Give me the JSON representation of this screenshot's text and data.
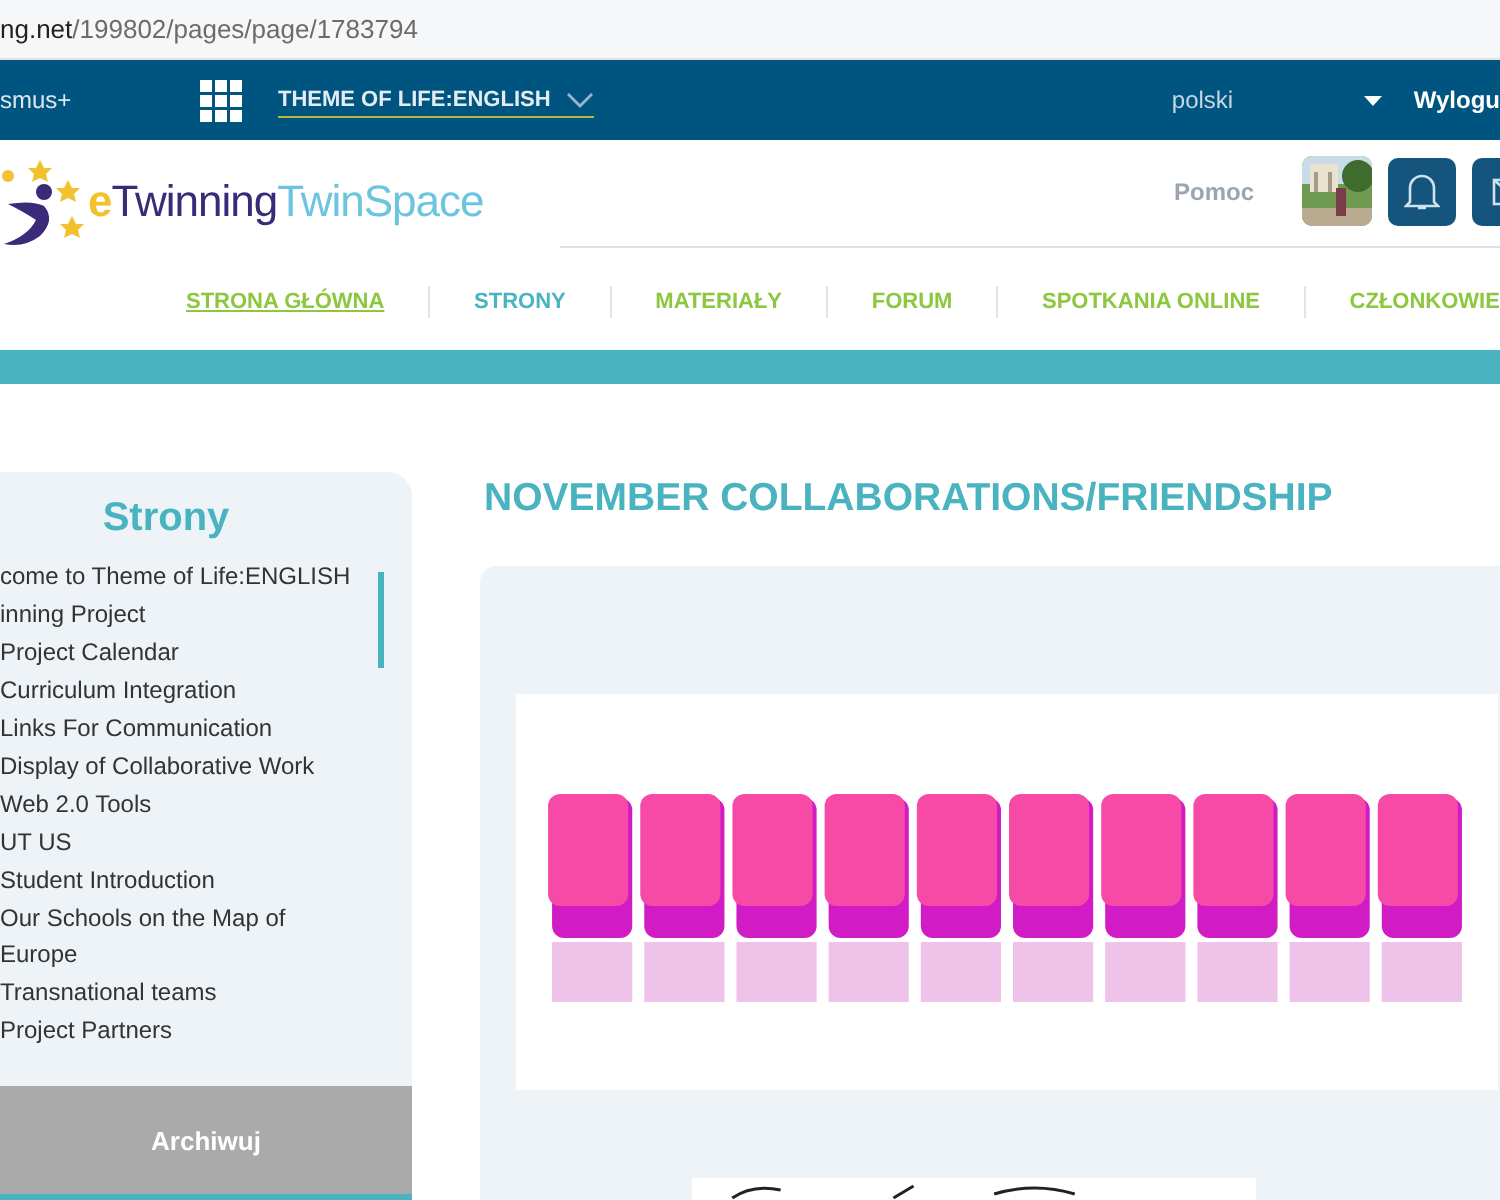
{
  "address_bar": {
    "host": "ng.net",
    "path": "/199802/pages/page/1783794"
  },
  "top_bar": {
    "program": "smus+",
    "space": "THEME OF LIFE:ENGLISH",
    "language": "polski",
    "logout": "Wylogu"
  },
  "header": {
    "logo": {
      "mark": "e",
      "name": "Twinning",
      "product": "TwinSpace"
    },
    "help": "Pomoc",
    "nav": [
      {
        "label": "STRONA GŁÓWNA",
        "selected": false,
        "underlined": true
      },
      {
        "label": "STRONY",
        "selected": true,
        "underlined": false
      },
      {
        "label": "MATERIAŁY",
        "selected": false,
        "underlined": false
      },
      {
        "label": "FORUM",
        "selected": false,
        "underlined": false
      },
      {
        "label": "SPOTKANIA ONLINE",
        "selected": false,
        "underlined": false
      },
      {
        "label": "CZŁONKOWIE",
        "selected": false,
        "underlined": false
      }
    ]
  },
  "sidebar": {
    "title": "Strony",
    "items": [
      {
        "label": "come to Theme of Life:ENGLISH"
      },
      {
        "label": "inning Project"
      },
      {
        "label": "Project Calendar"
      },
      {
        "label": "Curriculum Integration"
      },
      {
        "label": "Links For Communication"
      },
      {
        "label": "Display of Collaborative Work"
      },
      {
        "label": "Web 2.0 Tools"
      },
      {
        "label": "UT US"
      },
      {
        "label": "Student Introduction"
      },
      {
        "label": "Our Schools on the Map of Europe"
      },
      {
        "label": "Transnational teams"
      },
      {
        "label": "Project Partners"
      }
    ],
    "archive_button": "Archiwuj"
  },
  "page": {
    "title": "NOVEMBER COLLABORATIONS/FRIENDSHIP"
  }
}
